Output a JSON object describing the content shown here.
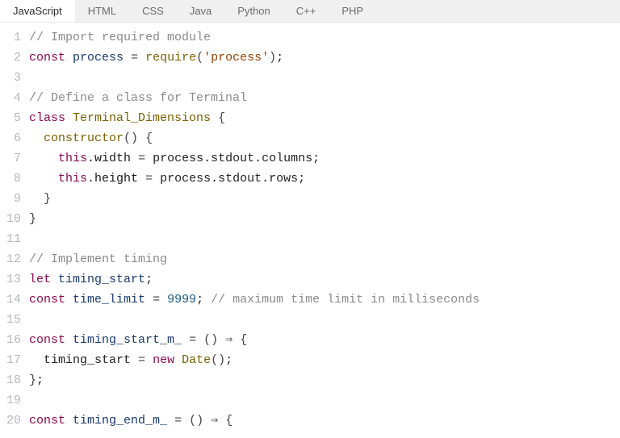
{
  "tabs": [
    {
      "label": "JavaScript",
      "active": true
    },
    {
      "label": "HTML"
    },
    {
      "label": "CSS"
    },
    {
      "label": "Java"
    },
    {
      "label": "Python"
    },
    {
      "label": "C++"
    },
    {
      "label": "PHP"
    }
  ],
  "code": [
    [
      {
        "c": "tk-comment",
        "t": "// Import required module"
      }
    ],
    [
      {
        "c": "tk-keyword",
        "t": "const"
      },
      {
        "c": "tk-plain",
        "t": " "
      },
      {
        "c": "tk-varname",
        "t": "process"
      },
      {
        "c": "tk-plain",
        "t": " "
      },
      {
        "c": "tk-operator",
        "t": "="
      },
      {
        "c": "tk-plain",
        "t": " "
      },
      {
        "c": "tk-classname",
        "t": "require"
      },
      {
        "c": "tk-paren",
        "t": "("
      },
      {
        "c": "tk-string",
        "t": "'process'"
      },
      {
        "c": "tk-paren",
        "t": ")"
      },
      {
        "c": "tk-plain",
        "t": ";"
      }
    ],
    [],
    [
      {
        "c": "tk-comment",
        "t": "// Define a class for Terminal"
      }
    ],
    [
      {
        "c": "tk-keyword",
        "t": "class"
      },
      {
        "c": "tk-plain",
        "t": " "
      },
      {
        "c": "tk-classname",
        "t": "Terminal_Dimensions"
      },
      {
        "c": "tk-plain",
        "t": " "
      },
      {
        "c": "tk-paren",
        "t": "{"
      }
    ],
    [
      {
        "c": "tk-plain",
        "t": "  "
      },
      {
        "c": "tk-classname",
        "t": "constructor"
      },
      {
        "c": "tk-paren",
        "t": "()"
      },
      {
        "c": "tk-plain",
        "t": " "
      },
      {
        "c": "tk-paren",
        "t": "{"
      }
    ],
    [
      {
        "c": "tk-plain",
        "t": "    "
      },
      {
        "c": "tk-keyword",
        "t": "this"
      },
      {
        "c": "tk-plain",
        "t": "."
      },
      {
        "c": "tk-prop",
        "t": "width"
      },
      {
        "c": "tk-plain",
        "t": " "
      },
      {
        "c": "tk-operator",
        "t": "="
      },
      {
        "c": "tk-plain",
        "t": " process.stdout.columns;"
      }
    ],
    [
      {
        "c": "tk-plain",
        "t": "    "
      },
      {
        "c": "tk-keyword",
        "t": "this"
      },
      {
        "c": "tk-plain",
        "t": "."
      },
      {
        "c": "tk-prop",
        "t": "height"
      },
      {
        "c": "tk-plain",
        "t": " "
      },
      {
        "c": "tk-operator",
        "t": "="
      },
      {
        "c": "tk-plain",
        "t": " process.stdout.rows;"
      }
    ],
    [
      {
        "c": "tk-plain",
        "t": "  "
      },
      {
        "c": "tk-paren",
        "t": "}"
      }
    ],
    [
      {
        "c": "tk-paren",
        "t": "}"
      }
    ],
    [],
    [
      {
        "c": "tk-comment",
        "t": "// Implement timing"
      }
    ],
    [
      {
        "c": "tk-keyword",
        "t": "let"
      },
      {
        "c": "tk-plain",
        "t": " "
      },
      {
        "c": "tk-varname",
        "t": "timing_start"
      },
      {
        "c": "tk-plain",
        "t": ";"
      }
    ],
    [
      {
        "c": "tk-keyword",
        "t": "const"
      },
      {
        "c": "tk-plain",
        "t": " "
      },
      {
        "c": "tk-varname",
        "t": "time_limit"
      },
      {
        "c": "tk-plain",
        "t": " "
      },
      {
        "c": "tk-operator",
        "t": "="
      },
      {
        "c": "tk-plain",
        "t": " "
      },
      {
        "c": "tk-number",
        "t": "9999"
      },
      {
        "c": "tk-plain",
        "t": "; "
      },
      {
        "c": "tk-comment",
        "t": "// maximum time limit in milliseconds"
      }
    ],
    [],
    [
      {
        "c": "tk-keyword",
        "t": "const"
      },
      {
        "c": "tk-plain",
        "t": " "
      },
      {
        "c": "tk-varname",
        "t": "timing_start_m_"
      },
      {
        "c": "tk-plain",
        "t": " "
      },
      {
        "c": "tk-operator",
        "t": "="
      },
      {
        "c": "tk-plain",
        "t": " "
      },
      {
        "c": "tk-paren",
        "t": "()"
      },
      {
        "c": "tk-plain",
        "t": " "
      },
      {
        "c": "tk-operator",
        "t": "⇒"
      },
      {
        "c": "tk-plain",
        "t": " "
      },
      {
        "c": "tk-paren",
        "t": "{"
      }
    ],
    [
      {
        "c": "tk-plain",
        "t": "  timing_start "
      },
      {
        "c": "tk-operator",
        "t": "="
      },
      {
        "c": "tk-plain",
        "t": " "
      },
      {
        "c": "tk-keyword",
        "t": "new"
      },
      {
        "c": "tk-plain",
        "t": " "
      },
      {
        "c": "tk-classname",
        "t": "Date"
      },
      {
        "c": "tk-paren",
        "t": "()"
      },
      {
        "c": "tk-plain",
        "t": ";"
      }
    ],
    [
      {
        "c": "tk-paren",
        "t": "}"
      },
      {
        "c": "tk-plain",
        "t": ";"
      }
    ],
    [],
    [
      {
        "c": "tk-keyword",
        "t": "const"
      },
      {
        "c": "tk-plain",
        "t": " "
      },
      {
        "c": "tk-varname",
        "t": "timing_end_m_"
      },
      {
        "c": "tk-plain",
        "t": " "
      },
      {
        "c": "tk-operator",
        "t": "="
      },
      {
        "c": "tk-plain",
        "t": " "
      },
      {
        "c": "tk-paren",
        "t": "()"
      },
      {
        "c": "tk-plain",
        "t": " "
      },
      {
        "c": "tk-operator",
        "t": "⇒"
      },
      {
        "c": "tk-plain",
        "t": " "
      },
      {
        "c": "tk-paren",
        "t": "{"
      }
    ]
  ]
}
